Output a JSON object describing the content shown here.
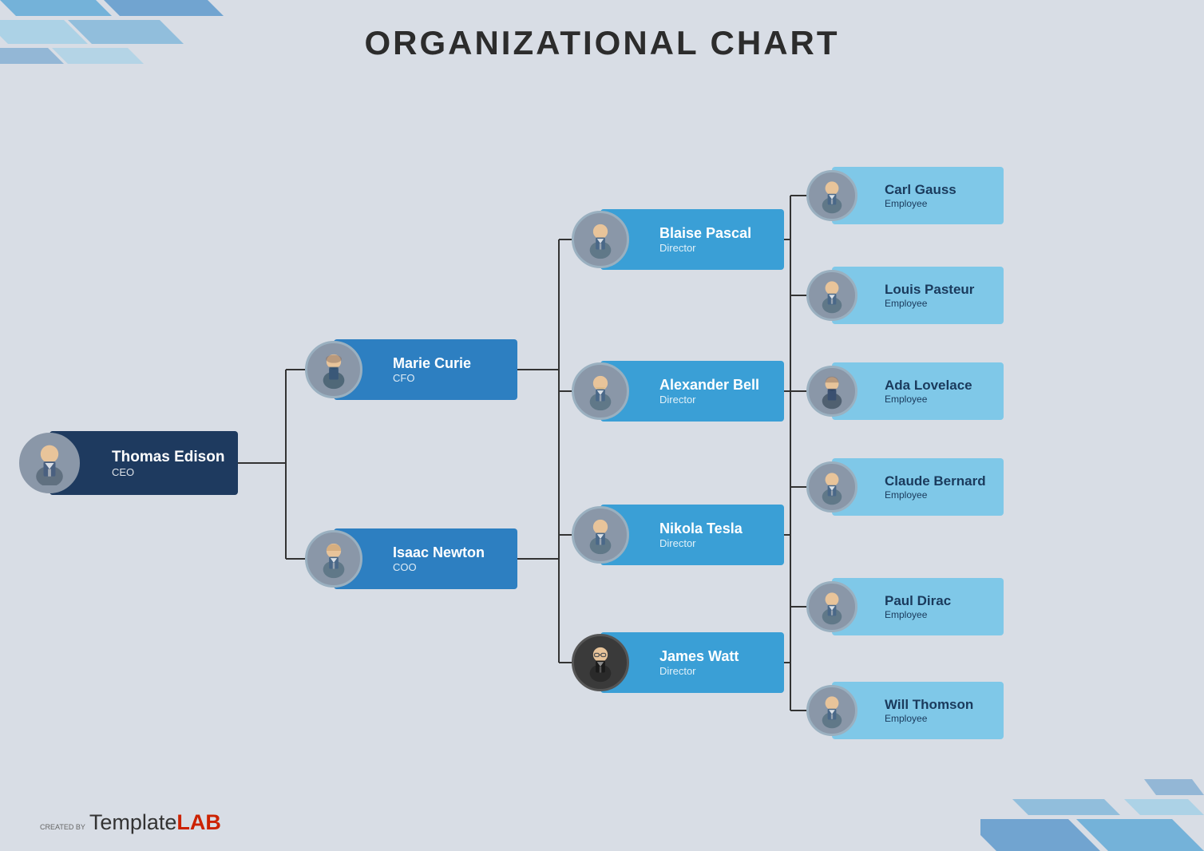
{
  "page": {
    "title": "ORGANIZATIONAL CHART"
  },
  "watermark": {
    "created_by": "CREATED BY",
    "template": "Template",
    "lab": "LAB"
  },
  "nodes": {
    "ceo": {
      "name": "Thomas Edison",
      "title": "CEO"
    },
    "managers": [
      {
        "name": "Marie Curie",
        "title": "CFO"
      },
      {
        "name": "Isaac Newton",
        "title": "COO"
      }
    ],
    "directors": [
      {
        "name": "Blaise Pascal",
        "title": "Director"
      },
      {
        "name": "Alexander Bell",
        "title": "Director"
      },
      {
        "name": "Nikola Tesla",
        "title": "Director"
      },
      {
        "name": "James Watt",
        "title": "Director"
      }
    ],
    "employees": [
      {
        "name": "Carl Gauss",
        "title": "Employee"
      },
      {
        "name": "Louis Pasteur",
        "title": "Employee"
      },
      {
        "name": "Ada Lovelace",
        "title": "Employee"
      },
      {
        "name": "Claude Bernard",
        "title": "Employee"
      },
      {
        "name": "Paul Dirac",
        "title": "Employee"
      },
      {
        "name": "Will Thomson",
        "title": "Employee"
      }
    ]
  },
  "colors": {
    "ceo_bg": "#1e3a5f",
    "manager_bg": "#2d7fc1",
    "director_bg": "#3a9fd6",
    "employee_bg": "#7fc8e8",
    "line_color": "#333333"
  }
}
